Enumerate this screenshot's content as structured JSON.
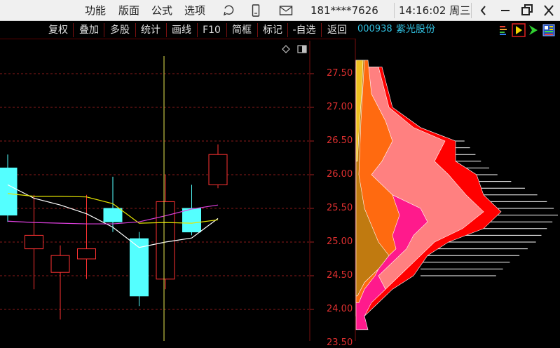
{
  "titlebar": {
    "menus": [
      "功能",
      "版面",
      "公式",
      "选项"
    ],
    "account": "181****7626",
    "clock": "14:16:02 周三"
  },
  "toolbar": {
    "buttons": [
      "复权",
      "叠加",
      "多股",
      "统计",
      "画线",
      "F10",
      "简框",
      "标记",
      "-自选",
      "返回"
    ]
  },
  "stock": {
    "code": "000938",
    "name": "紫光股份"
  },
  "chart_data": {
    "type": "candlestick",
    "y_ticks": [
      "27.50",
      "27.00",
      "26.50",
      "26.00",
      "25.50",
      "25.00",
      "24.50",
      "24.00",
      "23.50"
    ],
    "ylim": [
      23.5,
      27.8
    ],
    "candles": [
      {
        "open": 25.4,
        "high": 26.3,
        "low": 25.3,
        "close": 26.1,
        "dir": "up"
      },
      {
        "open": 25.1,
        "high": 25.7,
        "low": 24.3,
        "close": 24.9,
        "dir": "down"
      },
      {
        "open": 24.8,
        "high": 24.95,
        "low": 23.85,
        "close": 24.55,
        "dir": "down"
      },
      {
        "open": 24.9,
        "high": 25.7,
        "low": 24.45,
        "close": 24.75,
        "dir": "down"
      },
      {
        "open": 25.3,
        "high": 25.97,
        "low": 25.15,
        "close": 25.5,
        "dir": "up"
      },
      {
        "open": 24.2,
        "high": 25.15,
        "low": 24.05,
        "close": 25.05,
        "dir": "up"
      },
      {
        "open": 25.6,
        "high": 26.0,
        "low": 24.3,
        "close": 24.45,
        "dir": "down"
      },
      {
        "open": 25.15,
        "high": 25.85,
        "low": 25.1,
        "close": 25.5,
        "dir": "up"
      },
      {
        "open": 26.3,
        "high": 26.45,
        "low": 25.8,
        "close": 25.85,
        "dir": "down"
      }
    ],
    "ma": [
      {
        "color": "#ffffff",
        "values": [
          25.85,
          25.65,
          25.55,
          25.42,
          25.22,
          24.92,
          25.0,
          25.06,
          25.35
        ]
      },
      {
        "color": "#e6e600",
        "values": [
          25.72,
          25.68,
          25.68,
          25.67,
          25.57,
          25.28,
          25.29,
          25.28,
          25.33
        ]
      },
      {
        "color": "#e040e0",
        "values": [
          25.31,
          25.29,
          25.28,
          25.27,
          25.27,
          25.3,
          25.39,
          25.49,
          25.55
        ]
      }
    ],
    "chip_profile": [
      {
        "price": 24.5,
        "width": 0.55
      },
      {
        "price": 24.6,
        "width": 0.6
      },
      {
        "price": 24.7,
        "width": 0.65
      },
      {
        "price": 24.8,
        "width": 0.72
      },
      {
        "price": 24.9,
        "width": 0.78
      },
      {
        "price": 25.0,
        "width": 0.84
      },
      {
        "price": 25.1,
        "width": 0.88
      },
      {
        "price": 25.2,
        "width": 0.92
      },
      {
        "price": 25.3,
        "width": 0.96
      },
      {
        "price": 25.4,
        "width": 1.0
      },
      {
        "price": 25.5,
        "width": 0.97
      },
      {
        "price": 25.6,
        "width": 0.92
      },
      {
        "price": 25.7,
        "width": 0.85
      },
      {
        "price": 25.8,
        "width": 0.76
      },
      {
        "price": 25.9,
        "width": 0.66
      },
      {
        "price": 26.0,
        "width": 0.56
      },
      {
        "price": 26.1,
        "width": 0.5
      },
      {
        "price": 26.2,
        "width": 0.44
      },
      {
        "price": 26.3,
        "width": 0.4
      },
      {
        "price": 26.4,
        "width": 0.36
      },
      {
        "price": 26.5,
        "width": 0.32
      }
    ]
  }
}
